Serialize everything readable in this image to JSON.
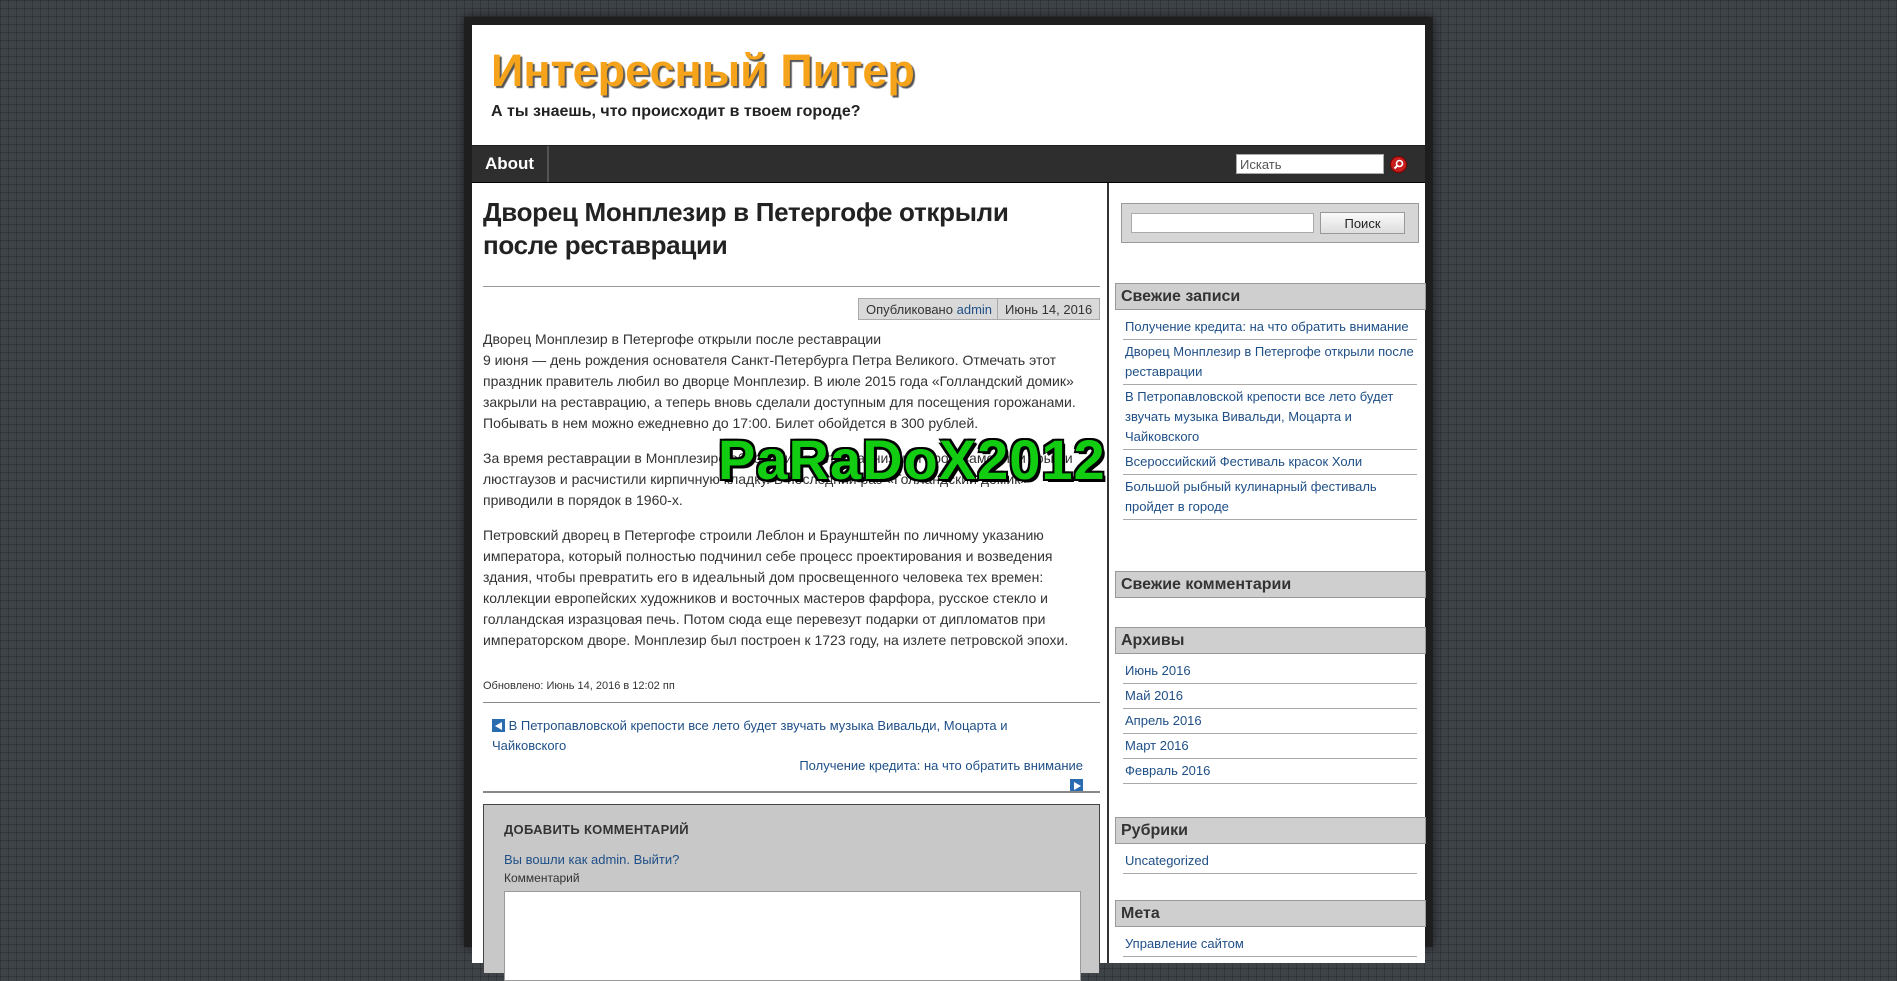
{
  "header": {
    "site_title": "Интересный Питер",
    "tagline": "А ты знаешь, что происходит в твоем городе?"
  },
  "nav": {
    "about": "About",
    "search_placeholder": "Искать"
  },
  "post": {
    "title": "Дворец Монплезир в Петергофе открыли после реставрации",
    "meta": {
      "published_prefix": "Опубликовано",
      "author": "admin",
      "date": "Июнь 14, 2016"
    },
    "paragraphs": [
      "Дворец Монплезир в Петергофе открыли после реставрации\n9 июня — день рождения основателя Санкт-Петербурга Петра Великого. Отмечать этот праздник правитель любил во дворце Монплезир. В июле 2015 года «Голландский домик» закрыли на реставрацию, а теперь вновь сделали доступным для посещения горожанами. Побывать в нем можно ежедневно до 17:00. Билет обойдется в 300 рублей.",
      "За время реставрации в Монплезире обновили отделку карнизов и арок, заменили крыши люстгаузов и расчистили кирпичную кладку. В последний раз «Голландский домик» приводили в порядок в 1960-х.",
      "Петровский дворец в Петергофе строили Леблон и Браунштейн по личному указанию императора, который полностью подчинил себе процесс проектирования и возведения здания, чтобы превратить его в идеальный дом просвещенного человека тех времен: коллекции европейских художников и восточных мастеров фарфора, русское стекло и голландская изразцовая печь. Потом сюда еще перевезут подарки от дипломатов при императорском дворе. Монплезир был построен к 1723 году, на излете петровской эпохи."
    ],
    "updated": "Обновлено: Июнь 14, 2016 в 12:02 пп",
    "prev_link": "В Петропавловской крепости все лето будет звучать музыка Вивальди, Моцарта и Чайковского",
    "next_link": "Получение кредита: на что обратить внимание"
  },
  "comments": {
    "heading": "ДОБАВИТЬ КОММЕНТАРИЙ",
    "logged_in": "Вы вошли как admin. Выйти?",
    "label": "Комментарий"
  },
  "sidebar": {
    "search_button": "Поиск",
    "recent_posts_title": "Свежие записи",
    "recent_posts": [
      "Получение кредита: на что обратить внимание",
      "Дворец Монплезир в Петергофе открыли после реставрации",
      "В Петропавловской крепости все лето будет звучать музыка Вивальди, Моцарта и Чайковского",
      "Всероссийский Фестиваль красок Холи",
      "Большой рыбный кулинарный фестиваль пройдет в городе"
    ],
    "recent_comments_title": "Свежие комментарии",
    "archives_title": "Архивы",
    "archives": [
      "Июнь 2016",
      "Май 2016",
      "Апрель 2016",
      "Март 2016",
      "Февраль 2016"
    ],
    "categories_title": "Рубрики",
    "categories": [
      "Uncategorized"
    ],
    "meta_title": "Мета",
    "meta_items": [
      "Управление сайтом"
    ]
  },
  "watermark": "PaRaDoX2012",
  "colors": {
    "title_orange": "#f5a31a",
    "link_blue": "#1f4f87",
    "watermark_green": "#11cc11"
  }
}
